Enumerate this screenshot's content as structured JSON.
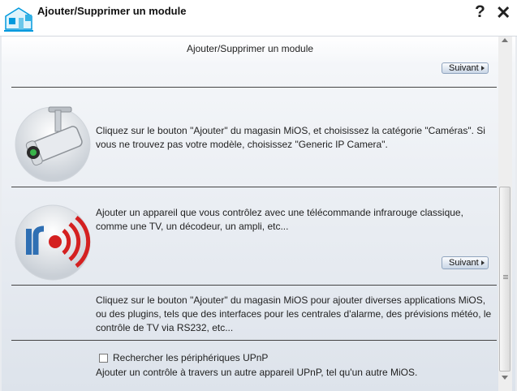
{
  "window": {
    "title": "Ajouter/Supprimer un module",
    "help_label": "?",
    "close_label": "✕"
  },
  "panel": {
    "subtitle": "Ajouter/Supprimer un module",
    "next_label": "Suivant",
    "sections": [
      {
        "icon": "camera-icon",
        "text": "Cliquez sur le bouton \"Ajouter\" du magasin MiOS, et choisissez la catégorie \"Caméras\". Si vous ne trouvez pas votre modèle, choisissez \"Generic IP Camera\"."
      },
      {
        "icon": "infrared-icon",
        "text": "Ajouter un appareil que vous contrôlez avec une télécommande infrarouge classique, comme une TV, un décodeur, un ampli, etc..."
      },
      {
        "text": "Cliquez sur le bouton \"Ajouter\" du magasin MiOS pour ajouter diverses applications MiOS, ou des plugins, tels que des interfaces pour les centrales d'alarme, des prévisions météo, le contrôle de TV via RS232, etc..."
      }
    ],
    "upnp": {
      "checkbox_label": "Rechercher les périphériques UPnP",
      "checked": false,
      "description": "Ajouter un contrôle à travers un autre appareil UPnP, tel qu'un autre MiOS."
    }
  },
  "colors": {
    "accent": "#0099dd",
    "button_border": "#8fa3bd",
    "ir_red": "#d42020"
  }
}
